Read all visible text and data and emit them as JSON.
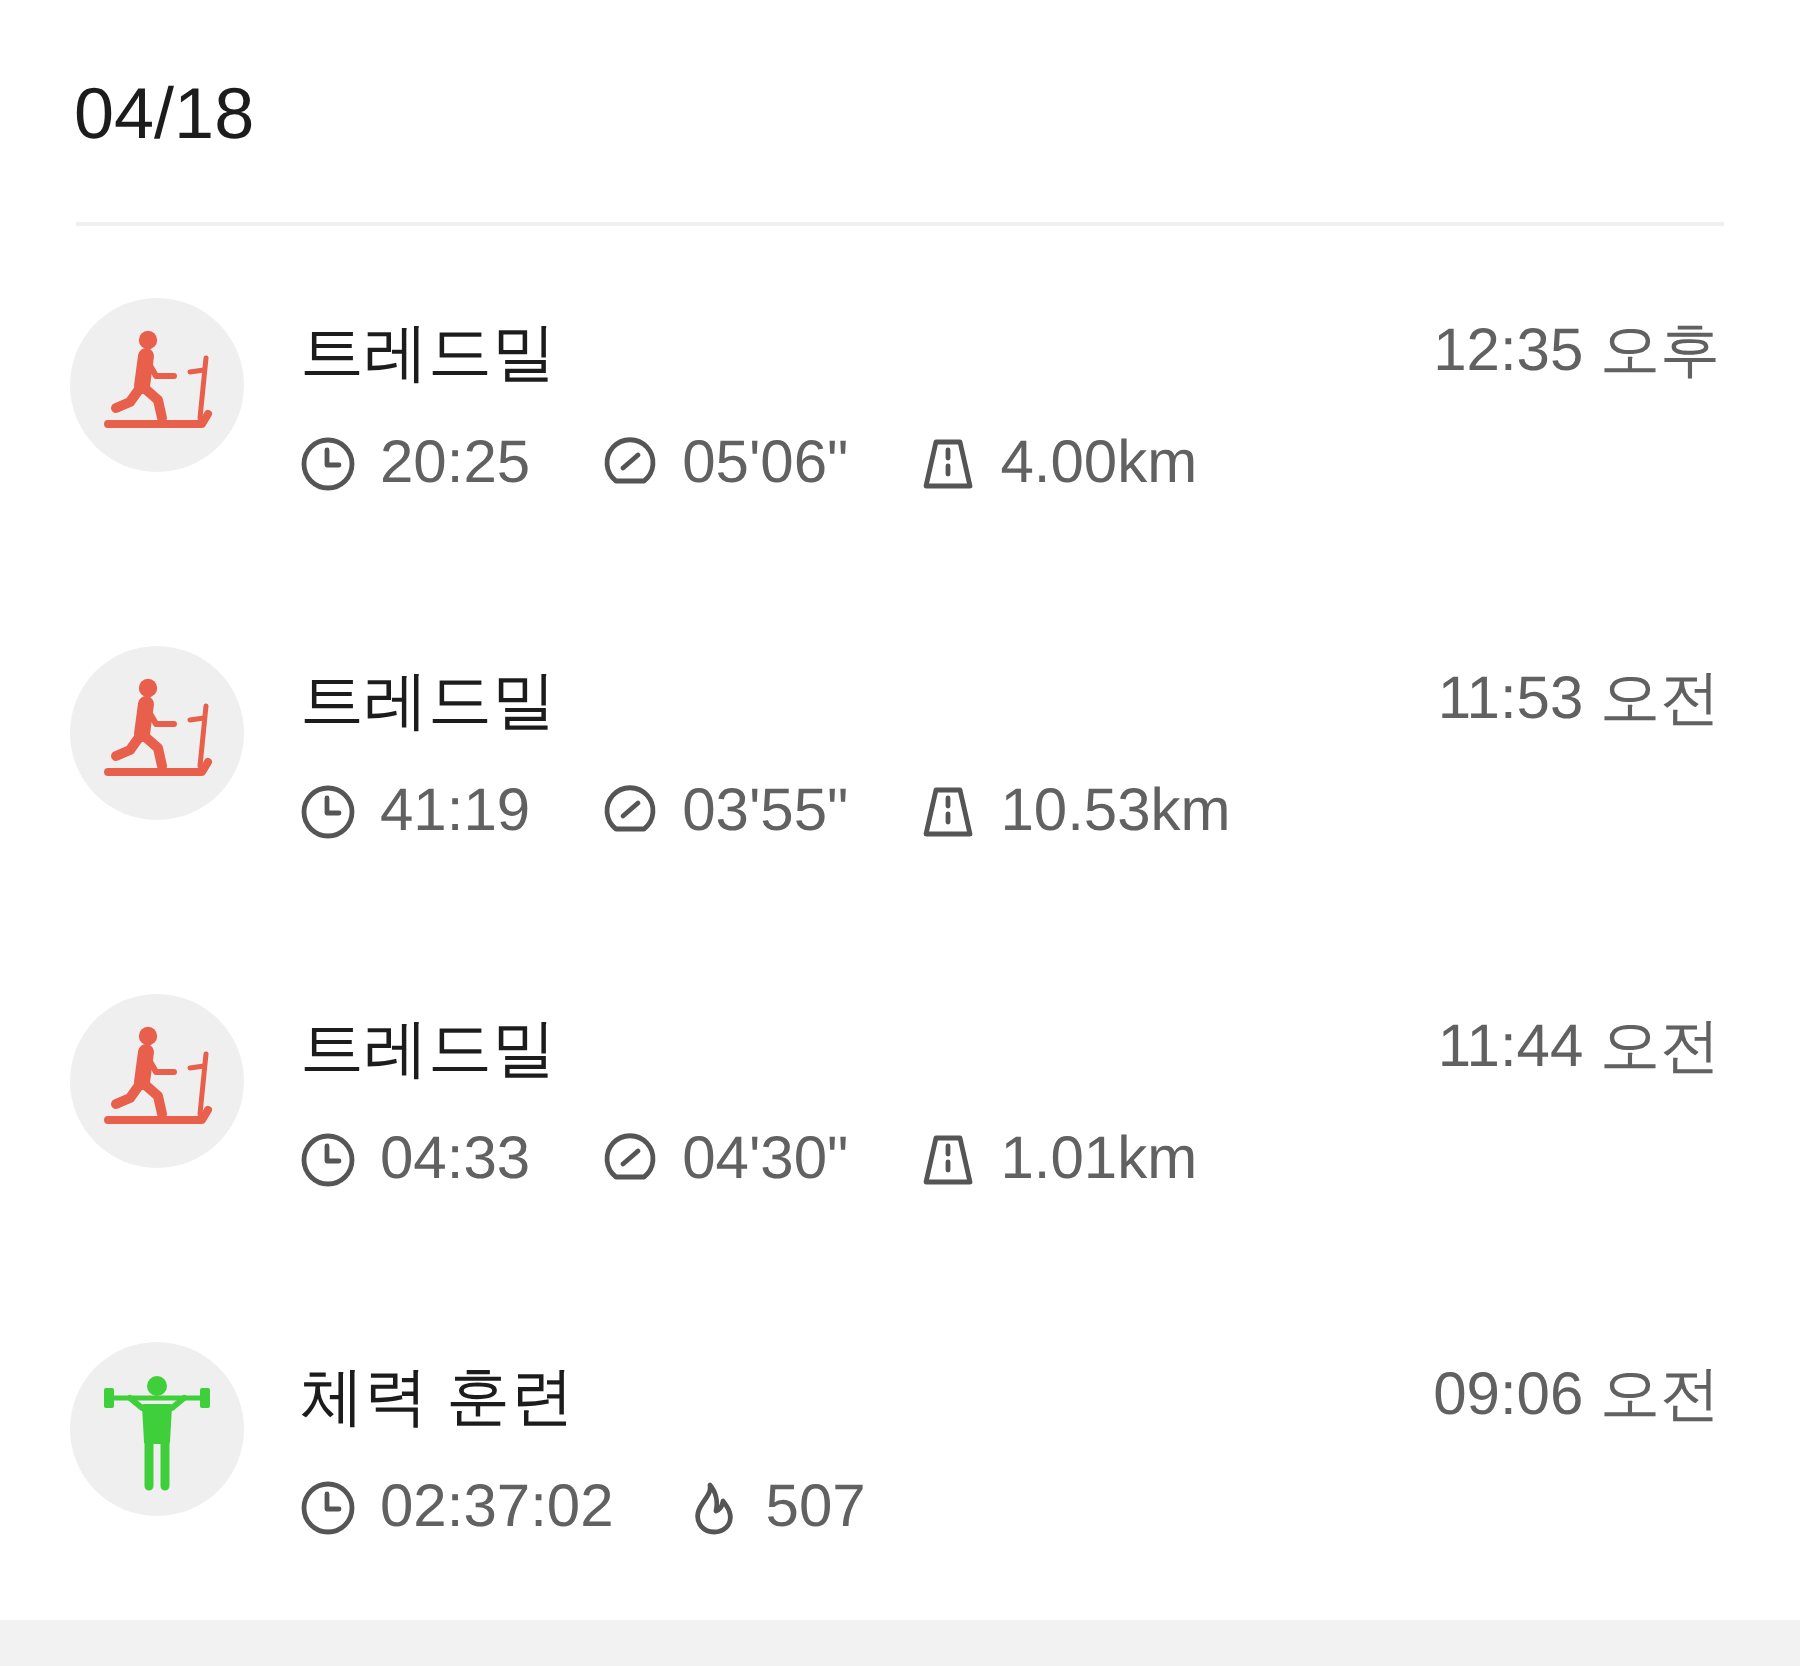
{
  "date": "04/18",
  "workouts": [
    {
      "kind": "treadmill",
      "title": "트레드밀",
      "time": "12:35 오후",
      "stats": [
        {
          "kind": "duration",
          "value": "20:25"
        },
        {
          "kind": "pace",
          "value": "05'06\""
        },
        {
          "kind": "distance",
          "value": "4.00km"
        }
      ]
    },
    {
      "kind": "treadmill",
      "title": "트레드밀",
      "time": "11:53 오전",
      "stats": [
        {
          "kind": "duration",
          "value": "41:19"
        },
        {
          "kind": "pace",
          "value": "03'55\""
        },
        {
          "kind": "distance",
          "value": "10.53km"
        }
      ]
    },
    {
      "kind": "treadmill",
      "title": "트레드밀",
      "time": "11:44 오전",
      "stats": [
        {
          "kind": "duration",
          "value": "04:33"
        },
        {
          "kind": "pace",
          "value": "04'30\""
        },
        {
          "kind": "distance",
          "value": "1.01km"
        }
      ]
    },
    {
      "kind": "strength",
      "title": "체력 훈련",
      "time": "09:06 오전",
      "stats": [
        {
          "kind": "duration",
          "value": "02:37:02"
        },
        {
          "kind": "calories",
          "value": "507"
        }
      ]
    }
  ]
}
